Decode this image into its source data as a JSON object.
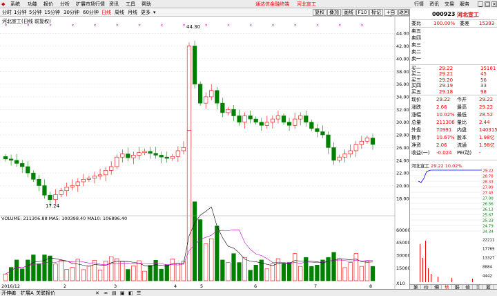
{
  "menubar": {
    "items": [
      "系统",
      "功能",
      "报价",
      "分析",
      "扩展市场行情",
      "资讯",
      "工具",
      "帮助"
    ],
    "promo": "通达信金融终端",
    "stock_title": "河北宣工",
    "right_tabs": [
      "行情",
      "资讯",
      "交易",
      "服务"
    ]
  },
  "toolbar": {
    "periods": [
      "分时",
      "1分钟",
      "5分钟",
      "15分钟",
      "30分钟",
      "60分钟",
      "日线",
      "周线",
      "月线",
      "更多"
    ],
    "active_period": "日线",
    "right_buttons": [
      "复权",
      "叠加",
      "画线",
      "F10",
      "标记",
      "+自选",
      "返回"
    ]
  },
  "chart": {
    "title": "河北宣工(日线 前复权)",
    "price_ticks": [
      "44.00",
      "42.00",
      "40.00",
      "38.00",
      "36.00",
      "34.00",
      "32.00",
      "30.00",
      "28.00",
      "26.00",
      "24.00",
      "22.00",
      "20.00",
      "18.00"
    ],
    "high_label": "44.30",
    "low_label": "17.24",
    "volume_info": "VOLUME: 211306.88  MA5: 100398.40  MA10: 106896.40",
    "volume_ticks": [
      "60000",
      "45000",
      "30000",
      "15000"
    ],
    "volume_unit": "X10",
    "date_labels": [
      "2016/12",
      "2",
      "3",
      "4",
      "5",
      "6",
      "7",
      "8"
    ],
    "period_label": "日线"
  },
  "chart_data": {
    "type": "candlestick",
    "title": "河北宣工(日线 前复权)",
    "ylim": [
      17,
      45
    ],
    "high": 44.3,
    "low": 17.24,
    "series": [
      {
        "name": "price (approx. close)",
        "values": [
          24.2,
          24.0,
          23.5,
          23.0,
          22.0,
          21.0,
          20.0,
          18.5,
          17.8,
          18.6,
          19.2,
          19.8,
          20.0,
          20.6,
          21.0,
          21.2,
          21.5,
          21.7,
          22.4,
          23.0,
          24.5,
          25.0,
          24.4,
          24.8,
          25.2,
          25.4,
          25.1,
          24.8,
          24.5,
          24.3,
          24.6,
          25.5,
          26.0,
          42.0,
          36.0,
          33.0,
          34.0,
          35.0,
          33.0,
          31.5,
          32.0,
          31.0,
          30.0,
          31.0,
          30.5,
          30.0,
          29.5,
          30.0,
          30.5,
          31.0,
          30.0,
          29.5,
          30.5,
          31.0,
          30.0,
          29.0,
          28.5,
          28.0,
          26.0,
          24.0,
          24.5,
          25.0,
          25.5,
          26.5,
          27.0,
          27.5,
          26.5
        ]
      }
    ]
  },
  "quote": {
    "code": "000923",
    "name": "河北宣工",
    "weibi_label": "委比",
    "weibi": "100.00%",
    "weicha_label": "委差",
    "weicha": "15393",
    "sell": [
      {
        "label": "卖五",
        "price": "",
        "vol": ""
      },
      {
        "label": "卖四",
        "price": "",
        "vol": ""
      },
      {
        "label": "卖三",
        "price": "",
        "vol": ""
      },
      {
        "label": "卖二",
        "price": "",
        "vol": ""
      },
      {
        "label": "卖一",
        "price": "",
        "vol": ""
      }
    ],
    "buy": [
      {
        "label": "买一",
        "price": "29.22",
        "vol": "15161"
      },
      {
        "label": "买二",
        "price": "29.21",
        "vol": "45"
      },
      {
        "label": "买三",
        "price": "29.20",
        "vol": "56"
      },
      {
        "label": "买四",
        "price": "29.19",
        "vol": "33"
      },
      {
        "label": "买五",
        "price": "29.18",
        "vol": "98"
      }
    ],
    "stats": [
      {
        "l1": "现价",
        "v1": "29.22",
        "l2": "今开",
        "v2": "29.22"
      },
      {
        "l1": "涨跌",
        "v1": "2.66",
        "l2": "最高",
        "v2": "29.22"
      },
      {
        "l1": "涨幅",
        "v1": "10.02%",
        "l2": "最低",
        "v2": "28.52"
      },
      {
        "l1": "总量",
        "v1": "211306",
        "l2": "量比",
        "v2": "2.44"
      },
      {
        "l1": "外盘",
        "v1": "70991",
        "l2": "内盘",
        "v2": "140315"
      },
      {
        "l1": "换手",
        "v1": "10.67%",
        "l2": "股本",
        "v2": "1.98亿"
      },
      {
        "l1": "净资",
        "v1": "2.06",
        "l2": "流通",
        "v2": "1.98亿"
      },
      {
        "l1": "收益(一)",
        "v1": "-0.024",
        "l2": "PE(动)",
        "v2": "-"
      }
    ],
    "mini_title": "河北宣工",
    "mini_price": "29.22",
    "mini_pct": "10.02%",
    "mini_ticks": [
      "29.22",
      "28.78",
      "28.33",
      "27.89",
      "27.45",
      "27.00",
      "26.56",
      "26.12",
      "25.67",
      "25.23",
      "24.79",
      "24.34"
    ],
    "mini_vol_ticks": [
      "22211",
      "17769",
      "13327",
      "8884",
      "4442"
    ]
  },
  "bottom": {
    "tabs": [
      "开伸编",
      "扩展A",
      "关联报价"
    ],
    "icons": [
      "✕",
      "♒",
      "▤",
      "▣",
      "◧",
      "☰"
    ]
  },
  "right_bottom_tabs": [
    "笔",
    "价",
    "细",
    "势",
    "联",
    "值",
    "主",
    "筹"
  ]
}
